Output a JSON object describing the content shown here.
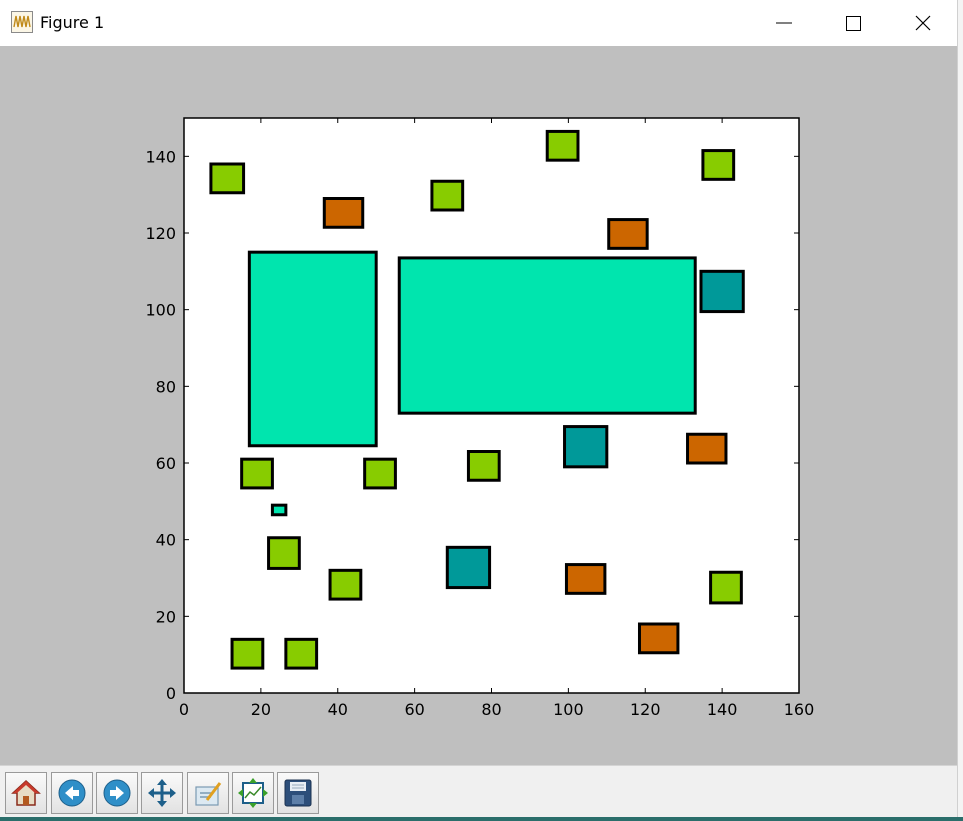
{
  "window": {
    "title": "Figure 1",
    "controls": [
      "minimize",
      "maximize",
      "close"
    ]
  },
  "toolbar": {
    "buttons": [
      {
        "name": "home-button",
        "icon": "home-icon"
      },
      {
        "name": "back-button",
        "icon": "back-arrow-icon"
      },
      {
        "name": "forward-button",
        "icon": "forward-arrow-icon"
      },
      {
        "name": "pan-button",
        "icon": "pan-icon"
      },
      {
        "name": "zoom-button",
        "icon": "zoom-rect-icon"
      },
      {
        "name": "configure-subplots-button",
        "icon": "subplots-icon"
      },
      {
        "name": "save-button",
        "icon": "save-icon"
      }
    ]
  },
  "chart_data": {
    "type": "rectangles",
    "xlim": [
      0,
      160
    ],
    "ylim": [
      0,
      150
    ],
    "xticks": [
      0,
      20,
      40,
      60,
      80,
      100,
      120,
      140,
      160
    ],
    "yticks": [
      0,
      20,
      40,
      60,
      80,
      100,
      120,
      140
    ],
    "grid": false,
    "colors": {
      "green": "#88cc00",
      "orange": "#cc6600",
      "teal": "#009999",
      "aqua": "#00e5ae",
      "edge": "#000000",
      "axes_bg": "#ffffff",
      "figure_bg": "#bfbfbf"
    },
    "rects": [
      {
        "x": 17,
        "y": 64.5,
        "w": 33,
        "h": 50.5,
        "color": "aqua"
      },
      {
        "x": 56,
        "y": 73,
        "w": 77,
        "h": 40.5,
        "color": "aqua"
      },
      {
        "x": 23,
        "y": 46.5,
        "w": 3.5,
        "h": 2.5,
        "color": "aqua"
      },
      {
        "x": 7,
        "y": 130.5,
        "w": 8.5,
        "h": 7.5,
        "color": "green"
      },
      {
        "x": 94.5,
        "y": 139,
        "w": 8,
        "h": 7.5,
        "color": "green"
      },
      {
        "x": 135,
        "y": 134,
        "w": 8,
        "h": 7.5,
        "color": "green"
      },
      {
        "x": 64.5,
        "y": 126,
        "w": 8,
        "h": 7.5,
        "color": "green"
      },
      {
        "x": 15,
        "y": 53.5,
        "w": 8,
        "h": 7.5,
        "color": "green"
      },
      {
        "x": 47,
        "y": 53.5,
        "w": 8,
        "h": 7.5,
        "color": "green"
      },
      {
        "x": 74,
        "y": 55.5,
        "w": 8,
        "h": 7.5,
        "color": "green"
      },
      {
        "x": 22,
        "y": 32.5,
        "w": 8,
        "h": 8,
        "color": "green"
      },
      {
        "x": 38,
        "y": 24.5,
        "w": 8,
        "h": 7.5,
        "color": "green"
      },
      {
        "x": 12.5,
        "y": 6.5,
        "w": 8,
        "h": 7.5,
        "color": "green"
      },
      {
        "x": 26.5,
        "y": 6.5,
        "w": 8,
        "h": 7.5,
        "color": "green"
      },
      {
        "x": 137,
        "y": 23.5,
        "w": 8,
        "h": 8,
        "color": "green"
      },
      {
        "x": 36.5,
        "y": 121.5,
        "w": 10,
        "h": 7.5,
        "color": "orange"
      },
      {
        "x": 110.5,
        "y": 116,
        "w": 10,
        "h": 7.5,
        "color": "orange"
      },
      {
        "x": 131,
        "y": 60,
        "w": 10,
        "h": 7.5,
        "color": "orange"
      },
      {
        "x": 99.5,
        "y": 26,
        "w": 10,
        "h": 7.5,
        "color": "orange"
      },
      {
        "x": 118.5,
        "y": 10.5,
        "w": 10,
        "h": 7.5,
        "color": "orange"
      },
      {
        "x": 134.5,
        "y": 99.5,
        "w": 11,
        "h": 10.5,
        "color": "teal"
      },
      {
        "x": 99,
        "y": 59,
        "w": 11,
        "h": 10.5,
        "color": "teal"
      },
      {
        "x": 68.5,
        "y": 27.5,
        "w": 11,
        "h": 10.5,
        "color": "teal"
      }
    ]
  }
}
